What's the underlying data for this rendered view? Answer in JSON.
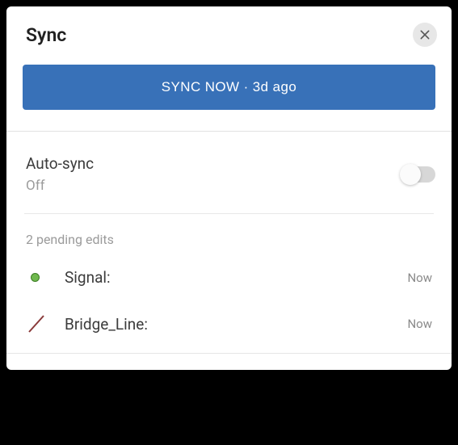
{
  "header": {
    "title": "Sync"
  },
  "syncButton": {
    "label": "SYNC NOW · 3d ago"
  },
  "autoSync": {
    "label": "Auto-sync",
    "status": "Off",
    "enabled": false
  },
  "pending": {
    "heading": "2 pending edits",
    "items": [
      {
        "icon": "point",
        "name": "Signal:",
        "time": "Now",
        "color": "#6fb84e"
      },
      {
        "icon": "line",
        "name": "Bridge_Line:",
        "time": "Now",
        "color": "#8a3a3a"
      }
    ]
  }
}
